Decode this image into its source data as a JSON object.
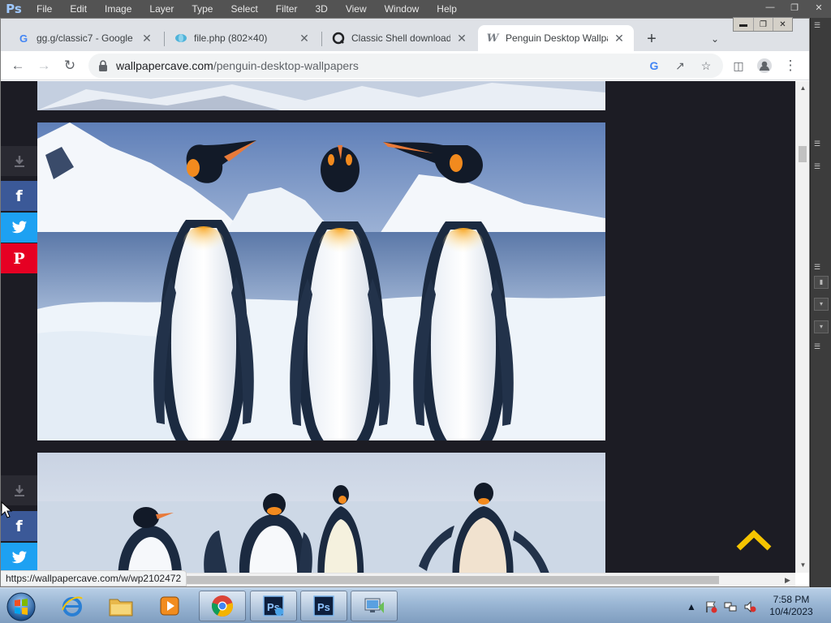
{
  "photoshop": {
    "logo": "Ps",
    "menus": [
      "File",
      "Edit",
      "Image",
      "Layer",
      "Type",
      "Select",
      "Filter",
      "3D",
      "View",
      "Window",
      "Help"
    ]
  },
  "browser": {
    "tabs": [
      {
        "title": "gg.g/classic7 - Google S",
        "favicon": "google-icon",
        "active": false
      },
      {
        "title": "file.php (802×40)",
        "favicon": "globe-icon",
        "active": false
      },
      {
        "title": "Classic Shell download f",
        "favicon": "classic-shell-icon",
        "active": false
      },
      {
        "title": "Penguin Desktop Wallpa",
        "favicon": "wallpapercave-icon",
        "active": true
      }
    ],
    "new_tab_label": "+",
    "url_domain": "wallpapercave.com",
    "url_path": "/penguin-desktop-wallpapers",
    "status_url": "https://wallpapercave.com/w/wp2102472"
  },
  "page": {
    "share_buttons": {
      "facebook": "f",
      "pinterest": "P"
    }
  },
  "taskbar": {
    "apps": [
      "internet-explorer-icon",
      "file-explorer-icon",
      "media-player-icon",
      "chrome-icon",
      "photoshop-icon",
      "photoshop-icon",
      "network-tool-icon"
    ],
    "photoshop_label": "Ps",
    "clock_time": "7:58 PM",
    "clock_date": "10/4/2023"
  },
  "colors": {
    "page_bg": "#1c1c24",
    "facebook": "#3b5998",
    "twitter": "#1da1f2",
    "pinterest": "#e60023",
    "scroll_top_arrow": "#f5c400"
  }
}
